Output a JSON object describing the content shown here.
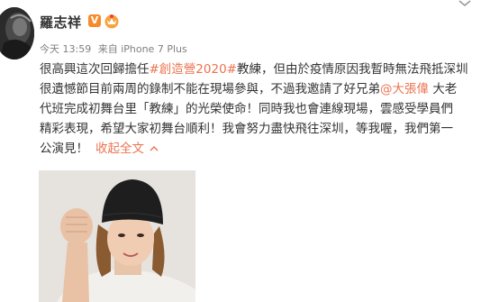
{
  "user": {
    "name": "羅志祥",
    "verified_badge": "V",
    "badge_color": "#f68b2b"
  },
  "meta": {
    "time": "今天 13:59",
    "source": "来自 iPhone 7 Plus"
  },
  "post": {
    "line1": {
      "a": "很高興這次回歸擔任",
      "topic": "#創造營2020#",
      "b": "教練，但由於疫情原因我暫時無法飛抵深圳"
    },
    "line2": {
      "a": "很遺憾節目前兩周的錄制不能在現場參與，不過我邀請了好兄弟",
      "mention": "@大張偉",
      "b": " 大老"
    },
    "line3": "代班完成初舞台里「教練」的光榮使命！同時我也會連線現場，雲感受學員們",
    "line4": "精彩表現，希望大家初舞台順利！我會努力盡快飛往深圳，等我喔，我們第一",
    "line5": "公演見！",
    "collapse_label": "收起全文"
  },
  "colors": {
    "link": "#eb7350",
    "meta": "#808080",
    "text": "#333333"
  },
  "icons": {
    "vip": "vip-crown-icon",
    "more": "chevron-down-icon",
    "collapse": "chevron-up-icon"
  }
}
